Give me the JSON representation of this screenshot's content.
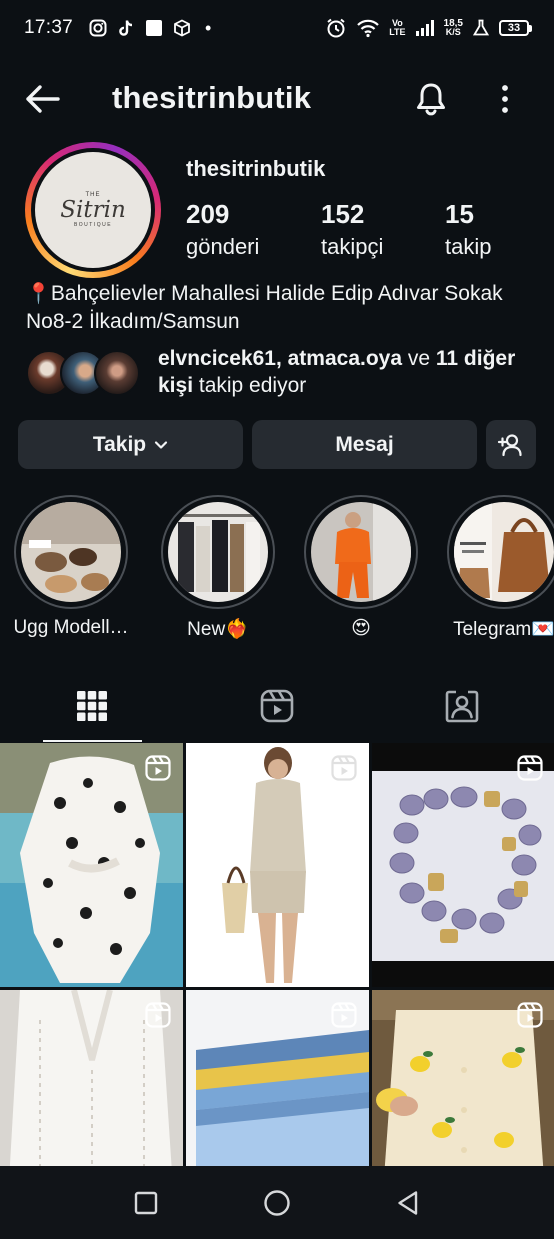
{
  "status_bar": {
    "time": "17:37",
    "volte": "Vo",
    "lte": "LTE",
    "speed_value": "18,5",
    "speed_unit": "K/S",
    "battery": "33",
    "dot": "•"
  },
  "top_bar": {
    "title": "thesitrinbutik"
  },
  "profile": {
    "username": "thesitrinbutik",
    "logo_small": "THE",
    "logo_name": "Sitrin",
    "logo_sub": "BOUTIQUE",
    "stats": [
      {
        "value": "209",
        "label": "gönderi"
      },
      {
        "value": "152",
        "label": "takipçi"
      },
      {
        "value": "15",
        "label": "takip"
      }
    ],
    "bio_pin": "📍",
    "bio_text": "Bahçelievler Mahallesi Halide Edip Adıvar Sokak No8-2 İlkadım/Samsun",
    "followed_by": {
      "user1": "elvncicek61",
      "sep": ", ",
      "user2": "atmaca.oya",
      "and": " ve ",
      "others": "11 diğer kişi",
      "suffix": " takip ediyor"
    }
  },
  "actions": {
    "follow_label": "Takip",
    "message_label": "Mesaj"
  },
  "highlights": [
    {
      "label": "Ugg Modell…"
    },
    {
      "label": "New❤️‍🔥"
    },
    {
      "label": "😍"
    },
    {
      "label": "Telegram💌"
    }
  ],
  "tabs": [
    {
      "icon": "grid-icon",
      "active": true
    },
    {
      "icon": "reels-icon",
      "active": false
    },
    {
      "icon": "tagged-icon",
      "active": false
    }
  ],
  "colors": {
    "background": "#0c1014",
    "button": "#262b31",
    "text": "#f2f4f5"
  }
}
